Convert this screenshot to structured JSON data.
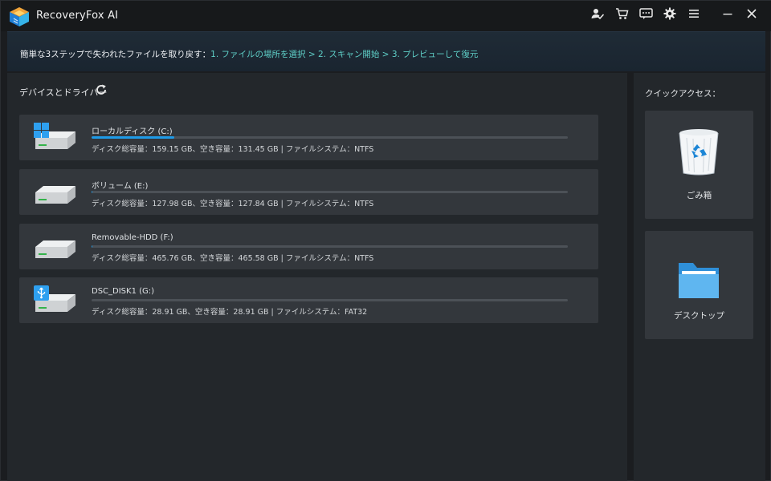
{
  "app": {
    "title": "RecoveryFox AI"
  },
  "titlebar_icons": [
    {
      "name": "account-icon"
    },
    {
      "name": "cart-icon"
    },
    {
      "name": "feedback-icon"
    },
    {
      "name": "settings-gear-icon"
    },
    {
      "name": "menu-icon"
    },
    {
      "name": "minimize-icon"
    },
    {
      "name": "close-icon"
    }
  ],
  "banner": {
    "lead": "簡単な3ステップで失われたファイルを取り戻す：",
    "steps": "1. ファイルの場所を選択 > 2. スキャン開始 > 3. プレビューして復元"
  },
  "devices": {
    "title": "デバイスとドライバー",
    "refresh_icon": "refresh-icon",
    "drives": [
      {
        "name": "ローカルディスク (C:)",
        "icon": "windows-drive-icon",
        "used_fraction": 0.174,
        "info": "ディスク総容量：159.15 GB、空き容量：131.45 GB | ファイルシステム：NTFS"
      },
      {
        "name": "ボリューム (E:)",
        "icon": "hard-drive-icon",
        "used_fraction": 0.001,
        "info": "ディスク総容量：127.98 GB、空き容量：127.84 GB | ファイルシステム：NTFS"
      },
      {
        "name": "Removable-HDD (F:)",
        "icon": "hard-drive-icon",
        "used_fraction": 0.0004,
        "info": "ディスク総容量：465.76 GB、空き容量：465.58 GB | ファイルシステム：NTFS"
      },
      {
        "name": "DSC_DISK1 (G:)",
        "icon": "usb-drive-icon",
        "used_fraction": 0.0,
        "info": "ディスク総容量：28.91 GB、空き容量：28.91 GB | ファイルシステム：FAT32"
      }
    ]
  },
  "quick_access": {
    "title": "クイックアクセス：",
    "items": [
      {
        "label": "ごみ箱",
        "icon": "recycle-bin-icon"
      },
      {
        "label": "デスクトップ",
        "icon": "folder-icon"
      }
    ]
  },
  "colors": {
    "accent_teal": "#5fd0c8",
    "progress_blue": "#1e9be8"
  }
}
